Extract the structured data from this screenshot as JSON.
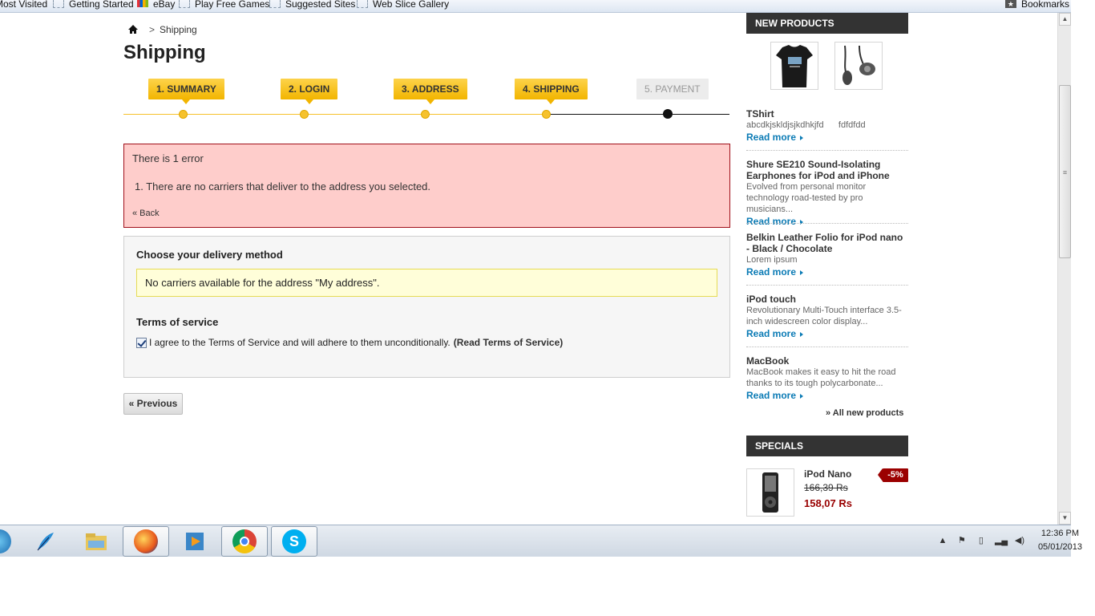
{
  "bookmarks": {
    "items": [
      {
        "label": "Most Visited"
      },
      {
        "label": "Getting Started"
      },
      {
        "label": "eBay"
      },
      {
        "label": "Play Free Games"
      },
      {
        "label": "Suggested Sites"
      },
      {
        "label": "Web Slice Gallery"
      }
    ],
    "right_label": "Bookmarks"
  },
  "breadcrumb": {
    "separator": ">",
    "current": "Shipping"
  },
  "page_title": "Shipping",
  "steps": [
    {
      "label": "1. Summary",
      "state": "done"
    },
    {
      "label": "2. Login",
      "state": "done"
    },
    {
      "label": "3. Address",
      "state": "done"
    },
    {
      "label": "4. Shipping",
      "state": "current"
    },
    {
      "label": "5. Payment",
      "state": "todo"
    }
  ],
  "error": {
    "title": "There is 1 error",
    "items": [
      "1.  There are no carriers that deliver to the address you selected."
    ],
    "back_label": "« Back"
  },
  "delivery": {
    "title": "Choose your delivery method",
    "warning": "No carriers available for the address \"My address\".",
    "tos_title": "Terms of service",
    "tos_text": "I agree to the Terms of Service and will adhere to them unconditionally.",
    "tos_link": "(Read Terms of Service)",
    "tos_checked": true
  },
  "previous_label": "« Previous",
  "new_products": {
    "header": "New products",
    "items": [
      {
        "name": "TShirt",
        "desc": "abcdkjskldjsjkdhkjfd      fdfdfdd",
        "more": "Read more"
      },
      {
        "name": "Shure SE210 Sound-Isolating Earphones for iPod and iPhone",
        "desc": "Evolved from personal monitor technology road-tested by pro musicians...",
        "more": "Read more"
      },
      {
        "name": "Belkin Leather Folio for iPod nano - Black / Chocolate",
        "desc": "Lorem ipsum",
        "more": "Read more"
      },
      {
        "name": "iPod touch",
        "desc": "Revolutionary Multi-Touch interface 3.5-inch widescreen color display...",
        "more": "Read more"
      },
      {
        "name": "MacBook",
        "desc": "MacBook makes it easy to hit the road thanks to its tough polycarbonate...",
        "more": "Read more"
      }
    ],
    "all_link": "» All new products"
  },
  "specials": {
    "header": "Specials",
    "name": "iPod Nano",
    "old_price": "166,39 Rs",
    "new_price": "158,07 Rs",
    "badge": "-5%"
  },
  "taskbar": {
    "time": "12:36 PM",
    "date": "05/01/2013"
  },
  "colors": {
    "accent": "#f6c22d",
    "error_bg": "#fecdcb",
    "error_border": "#a0101a",
    "warning_bg": "#fffed9",
    "link": "#0b7bb5",
    "price": "#990000"
  }
}
